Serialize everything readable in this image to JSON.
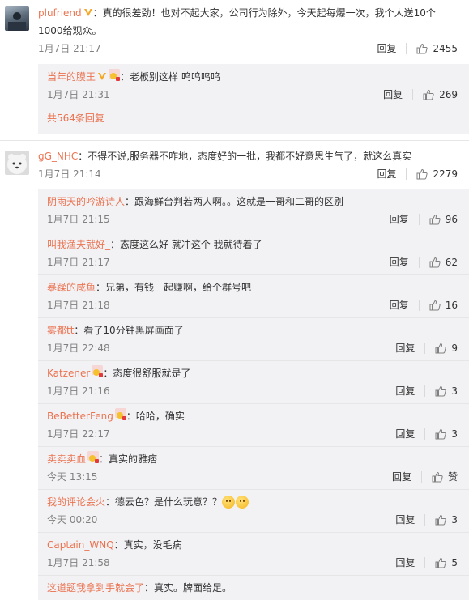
{
  "comments": [
    {
      "user": "plufriend",
      "verified": true,
      "text": "：真的很差劲！也对不起大家，公司行为除外，今天起每爆一次，我个人送10个1000给观众。",
      "time": "1月7日 21:17",
      "reply_label": "回复",
      "likes": "2455",
      "replies": [
        {
          "user": "当年的膜王",
          "verified": true,
          "level": true,
          "text": "：老板别这样 呜呜呜呜",
          "time": "1月7日 21:31",
          "reply_label": "回复",
          "likes": "269"
        }
      ],
      "more_replies": "共564条回复"
    },
    {
      "user": "gG_NHC",
      "verified": false,
      "text": "：不得不说,服务器不咋地，态度好的一批，我都不好意思生气了，就这么真实",
      "time": "1月7日 21:14",
      "reply_label": "回复",
      "likes": "2279",
      "replies": [
        {
          "user": "阴雨天的吟游诗人",
          "text": "：跟海鲜台判若两人啊。。这就是一哥和二哥的区别",
          "time": "1月7日 21:15",
          "reply_label": "回复",
          "likes": "96"
        },
        {
          "user": "叫我渔夫就好_",
          "text": "：态度这么好  就冲这个  我就待着了",
          "time": "1月7日 21:17",
          "reply_label": "回复",
          "likes": "62"
        },
        {
          "user": "暴躁的咸鱼",
          "text": "：兄弟，有钱一起赚啊，给个群号吧",
          "time": "1月7日 21:18",
          "reply_label": "回复",
          "likes": "16"
        },
        {
          "user": "雾都tt",
          "text": "：看了10分钟黑屏画面了",
          "time": "1月7日 22:48",
          "reply_label": "回复",
          "likes": "9"
        },
        {
          "user": "Katzener",
          "level": true,
          "text": "：态度很舒服就是了",
          "time": "1月7日 21:16",
          "reply_label": "回复",
          "likes": "3"
        },
        {
          "user": "BeBetterFeng",
          "level": true,
          "text": "：哈哈，确实",
          "time": "1月7日 22:17",
          "reply_label": "回复",
          "likes": "3"
        },
        {
          "user": "卖卖卖血",
          "level": true,
          "text": "：真实的雅痞",
          "time": "今天 13:15",
          "reply_label": "回复",
          "likes": "赞"
        },
        {
          "user": "我的评论会火",
          "text": "：德云色？是什么玩意？？",
          "emoji": true,
          "time": "今天 00:20",
          "reply_label": "回复",
          "likes": "3"
        },
        {
          "user": "Captain_WNQ",
          "text": "：真实，没毛病",
          "time": "1月7日 21:58",
          "reply_label": "回复",
          "likes": "5"
        },
        {
          "user": "这道题我拿到手就会了",
          "text": "：真实。牌面给足。",
          "time": "",
          "reply_label": "",
          "likes": ""
        }
      ]
    }
  ],
  "colors": {
    "link": "#eb7350",
    "reply_bg": "#f2f2f5",
    "meta": "#808080"
  }
}
